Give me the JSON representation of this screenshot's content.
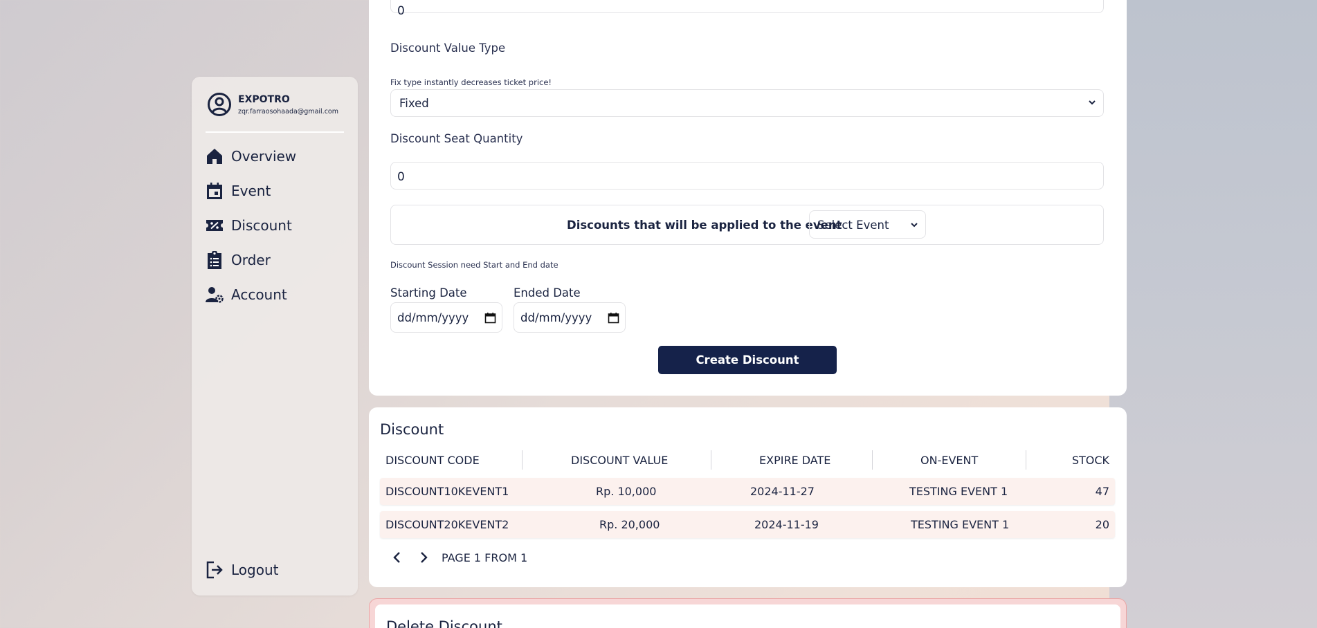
{
  "profile": {
    "name": "EXPOTRO",
    "email": "zqr.farraosohaada@gmail.com"
  },
  "nav": {
    "overview": "Overview",
    "event": "Event",
    "discount": "Discount",
    "order": "Order",
    "account": "Account",
    "logout": "Logout"
  },
  "form": {
    "top_value": "0",
    "value_type_label": "Discount Value Type",
    "value_type_hint": "Fix type instantly decreases ticket price!",
    "value_type_selected": "Fixed",
    "seat_qty_label": "Discount Seat Quantity",
    "seat_qty_value": "0",
    "event_label": "Discounts that will be applied to the event",
    "event_select": "Select Event",
    "session_hint": "Discount Session need Start and End date",
    "start_label": "Starting Date",
    "end_label": "Ended Date",
    "date_placeholder": "dd/mm/yyyy",
    "create_button": "Create Discount"
  },
  "table": {
    "title": "Discount",
    "headers": [
      "DISCOUNT CODE",
      "DISCOUNT VALUE",
      "EXPIRE DATE",
      "ON-EVENT",
      "STOCK"
    ],
    "rows": [
      [
        "DISCOUNT10KEVENT1",
        "Rp. 10,000",
        "2024-11-27",
        "TESTING EVENT 1",
        "47"
      ],
      [
        "DISCOUNT20KEVENT2",
        "Rp. 20,000",
        "2024-11-19",
        "TESTING EVENT 1",
        "20"
      ]
    ],
    "pager_text": "PAGE 1 FROM 1"
  },
  "delete": {
    "title": "Delete Discount"
  },
  "colors": {
    "primary": "#15224a",
    "row_bg": "#fcf1ee",
    "delete_border": "#eaa6a6"
  }
}
